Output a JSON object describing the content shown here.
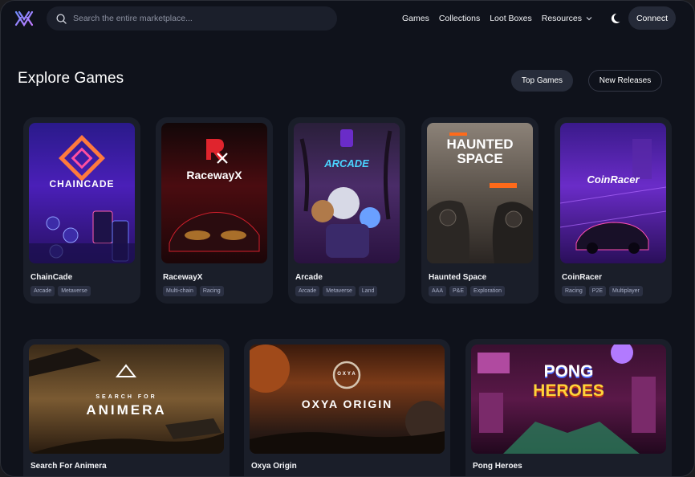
{
  "nav": {
    "search_placeholder": "Search the entire marketplace...",
    "links": [
      "Games",
      "Collections",
      "Loot Boxes",
      "Resources"
    ],
    "connect_label": "Connect"
  },
  "header": {
    "title": "Explore Games",
    "filters": [
      "Top Games",
      "New Releases"
    ]
  },
  "games": [
    {
      "name": "ChainCade",
      "art_title": "CHAINCADE",
      "tags": [
        "Arcade",
        "Metaverse"
      ]
    },
    {
      "name": "RacewayX",
      "art_title": "RacewayX",
      "tags": [
        "Multi-chain",
        "Racing"
      ]
    },
    {
      "name": "Arcade",
      "art_title": "ARCADE",
      "tags": [
        "Arcade",
        "Metaverse",
        "Land"
      ]
    },
    {
      "name": "Haunted Space",
      "art_title": "HAUNTED SPACE",
      "tags": [
        "AAA",
        "P&E",
        "Exploration"
      ]
    },
    {
      "name": "CoinRacer",
      "art_title": "CoinRacer",
      "tags": [
        "Racing",
        "P2E",
        "Multiplayer"
      ]
    },
    {
      "name": "Search For Animera",
      "art_title_top": "SEARCH FOR",
      "art_title": "ANIMERA"
    },
    {
      "name": "Oxya Origin",
      "art_title_top": "OXYA",
      "art_title": "OXYA ORIGIN"
    },
    {
      "name": "Pong Heroes",
      "art_title_top": "PONG",
      "art_title": "HEROES"
    }
  ],
  "colors": {
    "background": "#0f121b",
    "card": "#1a1e29",
    "tag_bg": "#2b3042",
    "accent": "#7b6cf6"
  }
}
